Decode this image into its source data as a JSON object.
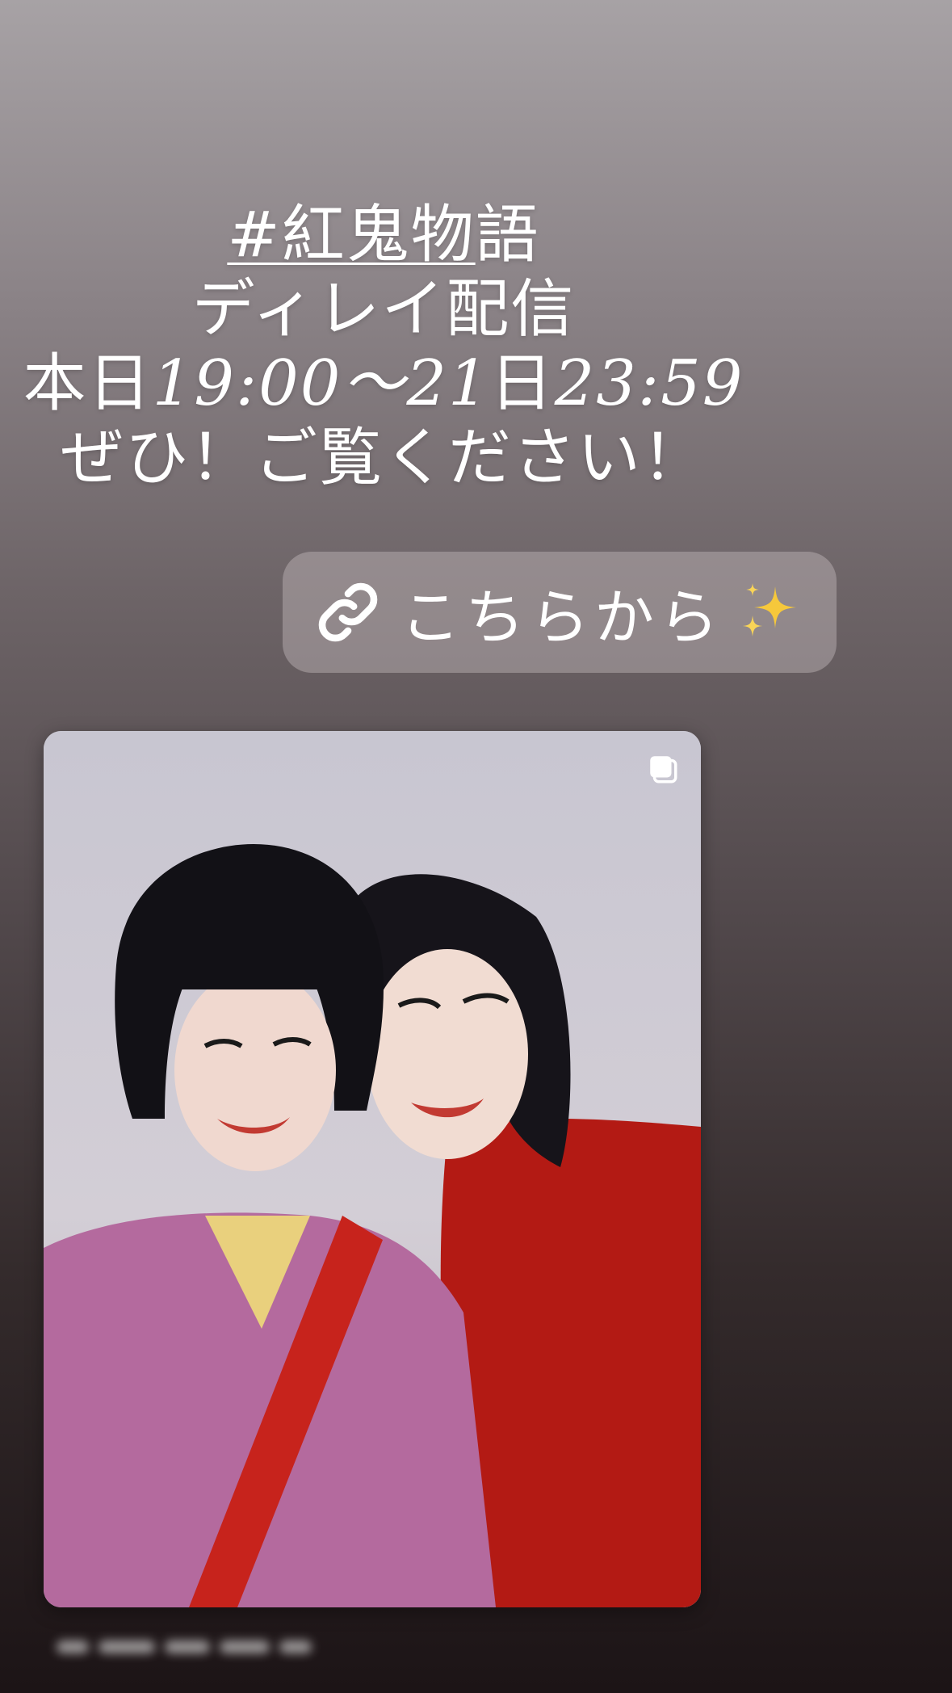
{
  "story": {
    "hashtag_part": "#紅鬼物",
    "hashtag_tail": "語",
    "line2": "ディレイ配信",
    "line3_a": "本日",
    "line3_b": "19:00〜21",
    "line3_c": "日",
    "line3_d": "23:59",
    "line4": "ぜひ！ご覧ください！"
  },
  "link_sticker": {
    "label": "こちらから",
    "icon": "link-icon",
    "emoji": "sparkles-icon"
  },
  "post_card": {
    "icon": "carousel-icon"
  },
  "colors": {
    "sticker_bg": "#c8bec0",
    "kimono_pink": "#b46a9e",
    "kimono_red": "#b31a14",
    "sparkle_yellow": "#f6c83b"
  }
}
